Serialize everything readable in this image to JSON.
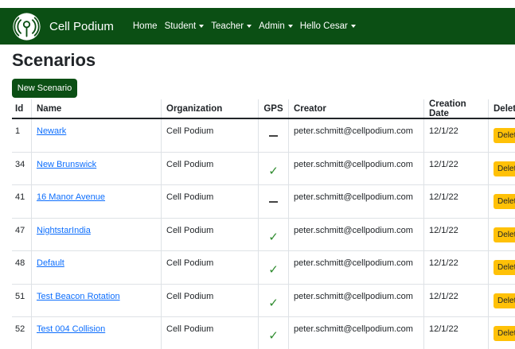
{
  "navbar": {
    "brand": "Cell Podium",
    "items": [
      {
        "label": "Home",
        "dropdown": false
      },
      {
        "label": "Student",
        "dropdown": true
      },
      {
        "label": "Teacher",
        "dropdown": true
      },
      {
        "label": "Admin",
        "dropdown": true
      },
      {
        "label": "Hello Cesar",
        "dropdown": true
      }
    ],
    "color": "#0b4f14"
  },
  "page": {
    "title": "Scenarios",
    "new_button": "New Scenario"
  },
  "table": {
    "columns": [
      "Id",
      "Name",
      "Organization",
      "GPS",
      "Creator",
      "Creation Date",
      "Delete"
    ],
    "rows": [
      {
        "id": "1",
        "name": "Newark",
        "org": "Cell Podium",
        "gps": false,
        "creator": "peter.schmitt@cellpodium.com",
        "date": "12/1/22",
        "delete": "Delete"
      },
      {
        "id": "34",
        "name": "New Brunswick",
        "org": "Cell Podium",
        "gps": true,
        "creator": "peter.schmitt@cellpodium.com",
        "date": "12/1/22",
        "delete": "Delete"
      },
      {
        "id": "41",
        "name": "16 Manor Avenue",
        "org": "Cell Podium",
        "gps": false,
        "creator": "peter.schmitt@cellpodium.com",
        "date": "12/1/22",
        "delete": "Delete"
      },
      {
        "id": "47",
        "name": "NightstarIndia",
        "org": "Cell Podium",
        "gps": true,
        "creator": "peter.schmitt@cellpodium.com",
        "date": "12/1/22",
        "delete": "Delete"
      },
      {
        "id": "48",
        "name": "Default",
        "org": "Cell Podium",
        "gps": true,
        "creator": "peter.schmitt@cellpodium.com",
        "date": "12/1/22",
        "delete": "Delete"
      },
      {
        "id": "51",
        "name": "Test Beacon Rotation",
        "org": "Cell Podium",
        "gps": true,
        "creator": "peter.schmitt@cellpodium.com",
        "date": "12/1/22",
        "delete": "Delete"
      },
      {
        "id": "52",
        "name": "Test 004 Collision",
        "org": "Cell Podium",
        "gps": true,
        "creator": "peter.schmitt@cellpodium.com",
        "date": "12/1/22",
        "delete": "Delete"
      }
    ],
    "gps_icons": {
      "true": "check-icon",
      "false": "dash-icon"
    }
  }
}
